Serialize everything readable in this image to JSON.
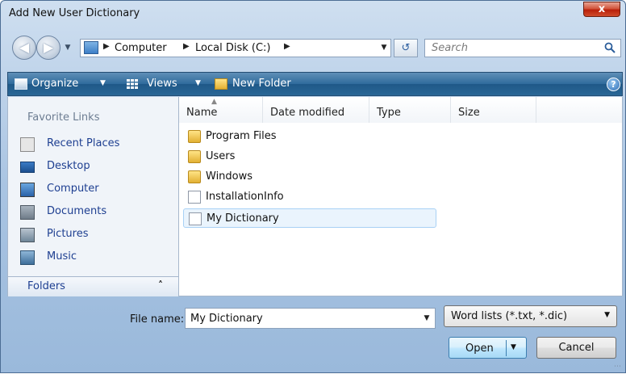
{
  "window": {
    "title": "Add New User Dictionary",
    "close_label": "x"
  },
  "address": {
    "crumbs": [
      "Computer",
      "Local Disk (C:)"
    ],
    "search_placeholder": "Search"
  },
  "toolbar": {
    "organize": "Organize",
    "views": "Views",
    "new_folder": "New Folder",
    "help": "?"
  },
  "sidebar": {
    "header": "Favorite Links",
    "items": [
      {
        "label": "Recent Places",
        "icon": "recent-places-icon"
      },
      {
        "label": "Desktop",
        "icon": "desktop-icon"
      },
      {
        "label": "Computer",
        "icon": "computer-icon"
      },
      {
        "label": "Documents",
        "icon": "documents-icon"
      },
      {
        "label": "Pictures",
        "icon": "pictures-icon"
      },
      {
        "label": "Music",
        "icon": "music-icon"
      }
    ],
    "folders_label": "Folders"
  },
  "filelist": {
    "columns": [
      "Name",
      "Date modified",
      "Type",
      "Size"
    ],
    "rows": [
      {
        "name": "Program Files",
        "kind": "folder"
      },
      {
        "name": "Users",
        "kind": "folder"
      },
      {
        "name": "Windows",
        "kind": "folder"
      },
      {
        "name": "InstallationInfo",
        "kind": "file"
      },
      {
        "name": "My Dictionary",
        "kind": "file",
        "selected": true
      }
    ]
  },
  "footer": {
    "filename_label": "File name:",
    "filename_value": "My Dictionary",
    "filetype_value": "Word lists (*.txt, *.dic)",
    "open_label": "Open",
    "cancel_label": "Cancel"
  },
  "colors": {
    "toolbar": "#2f6b9c",
    "link_text": "#1e3f91",
    "selection": "#eaf4fd"
  }
}
